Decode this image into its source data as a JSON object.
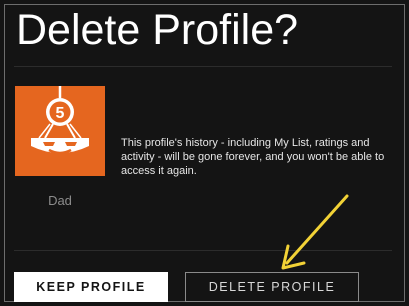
{
  "dialog": {
    "title": "Delete Profile?",
    "message": "This profile's history - including My List, ratings and activity - will be gone forever, and you won't be able to access it again."
  },
  "profile": {
    "name": "Dad",
    "avatar_badge": "5",
    "avatar_color": "#e5661f",
    "avatar_icon": "profile-avatar-icon"
  },
  "actions": {
    "keep_label": "KEEP PROFILE",
    "delete_label": "DELETE PROFILE"
  },
  "annotation": {
    "arrow_color": "#f2d236",
    "arrow_icon": "yellow-arrow-annotation"
  }
}
